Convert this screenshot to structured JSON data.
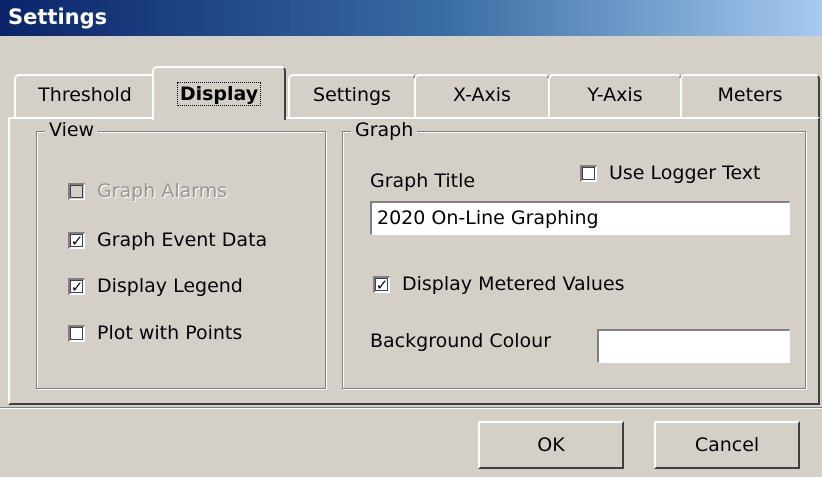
{
  "window": {
    "title": "Settings"
  },
  "tabs": [
    {
      "label": "Threshold",
      "active": false
    },
    {
      "label": "Display",
      "active": true
    },
    {
      "label": "Settings",
      "active": false
    },
    {
      "label": "X-Axis",
      "active": false
    },
    {
      "label": "Y-Axis",
      "active": false
    },
    {
      "label": "Meters",
      "active": false
    }
  ],
  "view": {
    "legend": "View",
    "options": [
      {
        "label": "Graph Alarms",
        "checked": false,
        "disabled": true
      },
      {
        "label": "Graph Event Data",
        "checked": true,
        "disabled": false
      },
      {
        "label": "Display Legend",
        "checked": true,
        "disabled": false
      },
      {
        "label": "Plot with Points",
        "checked": false,
        "disabled": false
      }
    ]
  },
  "graph": {
    "legend": "Graph",
    "title_label": "Graph Title",
    "use_logger_text": {
      "label": "Use Logger Text",
      "checked": false
    },
    "title_value": "2020 On-Line Graphing",
    "display_metered": {
      "label": "Display Metered Values",
      "checked": true
    },
    "background_label": "Background Colour",
    "background_color": "#ffffff"
  },
  "buttons": {
    "ok": "OK",
    "cancel": "Cancel"
  }
}
